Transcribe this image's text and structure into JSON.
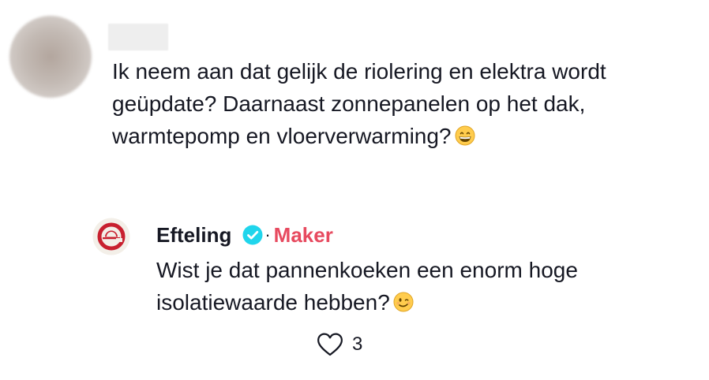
{
  "comment": {
    "username": "",
    "text": "Ik neem aan dat gelijk de riolering en elektra wordt geüpdate? Daarnaast zonnepanelen op het dak, warmtepomp en vloerverwarming?",
    "emoji": "grinning-face-emoji"
  },
  "reply": {
    "author_name": "Efteling",
    "verified_icon": "verified-check-icon",
    "separator": "·",
    "badge": "Maker",
    "text": "Wist je dat pannenkoeken een enorm hoge isolatiewaarde hebben?",
    "emoji": "winking-face-emoji",
    "like_icon": "heart-outline-icon",
    "like_count": "3"
  },
  "colors": {
    "text": "#161823",
    "maker_badge": "#e74a5f",
    "verified": "#20d5ec",
    "logo_red": "#c8202f"
  }
}
